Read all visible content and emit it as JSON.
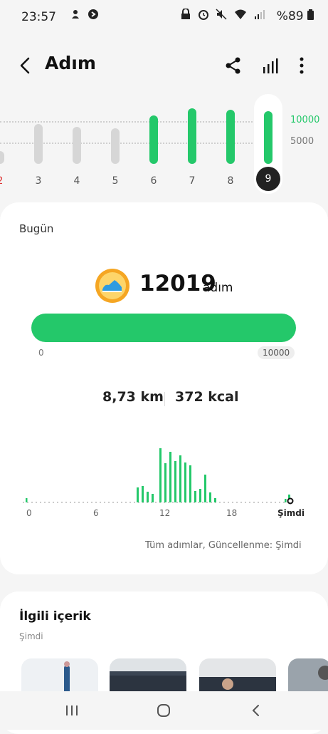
{
  "status_bar": {
    "time": "23:57",
    "left_icons": [
      "notification-icon",
      "shazam-icon"
    ],
    "right_icons": [
      "lock-icon",
      "alarm-icon",
      "mute-icon",
      "wifi-icon",
      "signal-icon"
    ],
    "battery": "%89"
  },
  "header": {
    "title": "Adım",
    "actions": [
      "share-icon",
      "chart-icon",
      "more-icon"
    ]
  },
  "week_chart": {
    "days": [
      "2",
      "3",
      "4",
      "5",
      "6",
      "7",
      "8",
      "9"
    ],
    "selected_day": "9",
    "goal_label": "10000",
    "half_label": "5000",
    "goal_color": "#24c86a"
  },
  "today": {
    "label": "Bugün",
    "steps": "12019",
    "steps_unit": "adım",
    "progress_min": "0",
    "progress_max": "10000",
    "progress_fraction": 1.0,
    "distance": "8,73 km",
    "calories": "372 kcal",
    "hourly_axis": [
      "0",
      "6",
      "12",
      "18",
      "Şimdi"
    ],
    "footnote": "Tüm adımlar, Güncellenme: Şimdi"
  },
  "related": {
    "title": "İlgili içerik",
    "subtitle": "Şimdi"
  },
  "nav": [
    "recent-apps-icon",
    "home-icon",
    "back-icon"
  ],
  "colors": {
    "accent": "#24c86a",
    "inactive_bar": "#d6d6d6"
  }
}
